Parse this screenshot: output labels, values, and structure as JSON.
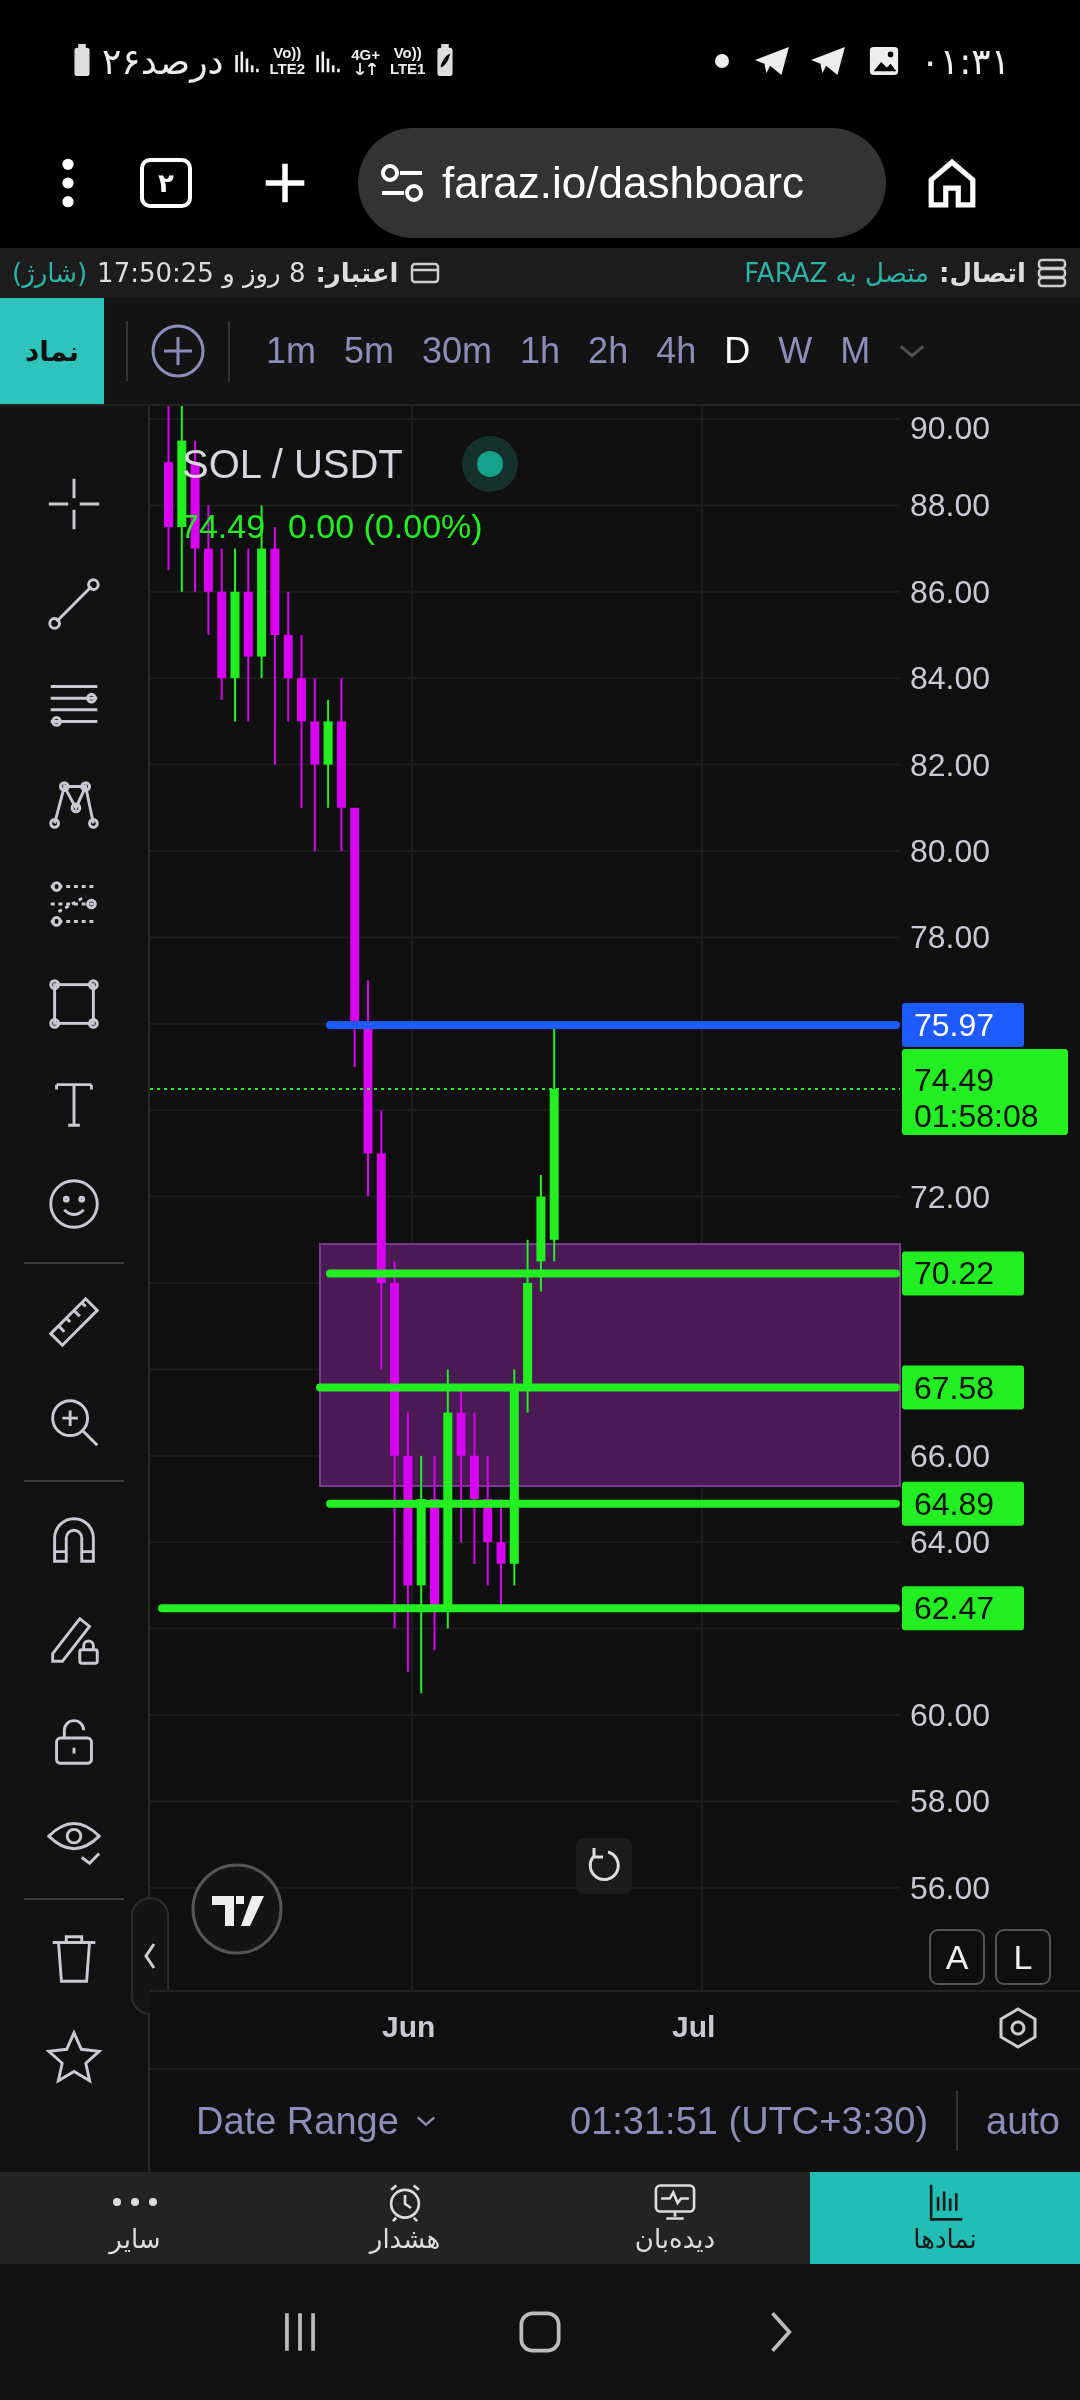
{
  "status_bar": {
    "time": "۰۱:۳۱",
    "battery": "۲۶درصد",
    "sim_1": [
      "Vo))",
      "LTE2"
    ],
    "sim_2": [
      "4G+",
      "Vo))",
      "LTE1"
    ]
  },
  "browser": {
    "url": "faraz.io/dashboarc",
    "tab_count": "۲"
  },
  "info_bar": {
    "connection_label": "اتصال:",
    "connection_value": "متصل به FARAZ",
    "credit_label": "اعتبار:",
    "credit_value": "8 روز و 17:50:25",
    "charge": "(شارژ)"
  },
  "toolbar": {
    "symbol_button": "نماد",
    "intervals": [
      {
        "label": "1m",
        "selected": false
      },
      {
        "label": "5m",
        "selected": false
      },
      {
        "label": "30m",
        "selected": false
      },
      {
        "label": "1h",
        "selected": false
      },
      {
        "label": "2h",
        "selected": false
      },
      {
        "label": "4h",
        "selected": false
      },
      {
        "label": "D",
        "selected": true
      },
      {
        "label": "W",
        "selected": false
      },
      {
        "label": "M",
        "selected": false
      }
    ]
  },
  "chart": {
    "symbol": "SOL / USDT",
    "last": "74.49",
    "change": "0.00 (0.00%)",
    "price_axis": [
      "90.00",
      "88.00",
      "86.00",
      "84.00",
      "82.00",
      "80.00",
      "78.00",
      "72.00",
      "66.00",
      "64.00",
      "60.00",
      "58.00",
      "56.00"
    ],
    "levels": [
      {
        "label": "75.97",
        "color": "#1e5bff"
      },
      {
        "label": "70.22",
        "color": "#22ee22"
      },
      {
        "label": "67.58",
        "color": "#22ee22"
      },
      {
        "label": "64.89",
        "color": "#22ee22"
      },
      {
        "label": "62.47",
        "color": "#22ee22"
      }
    ],
    "current": {
      "price": "74.49",
      "countdown": "01:58:08"
    },
    "x_axis": [
      "Jun",
      "Jul"
    ],
    "scale_buttons": [
      "A",
      "L"
    ]
  },
  "footer": {
    "date_range": "Date Range",
    "clock": "01:31:51 (UTC+3:30)",
    "scale": "auto"
  },
  "bottom_nav": [
    {
      "label": "نمادها",
      "kind": "symbols",
      "selected": true
    },
    {
      "label": "دیده‌بان",
      "kind": "watch",
      "selected": false
    },
    {
      "label": "هشدار",
      "kind": "alarm",
      "selected": false
    },
    {
      "label": "سایر",
      "kind": "more",
      "selected": false
    }
  ]
}
